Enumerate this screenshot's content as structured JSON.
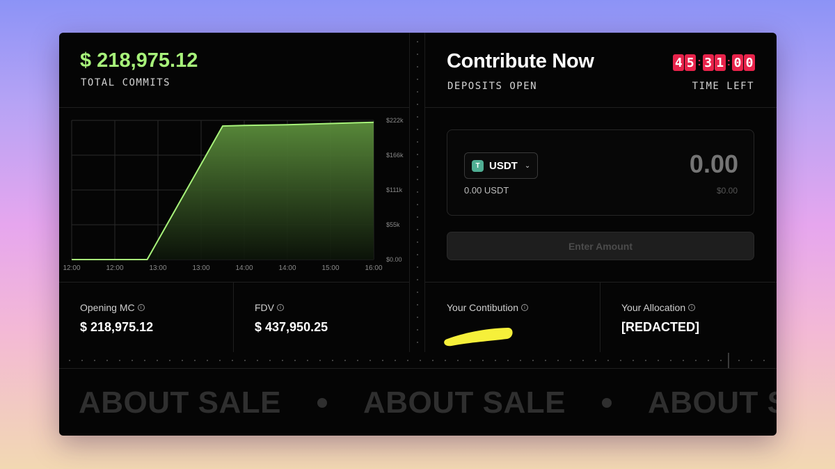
{
  "commits": {
    "value": "$ 218,975.12",
    "label": "TOTAL COMMITS"
  },
  "contribute": {
    "title": "Contribute Now",
    "status": "DEPOSITS OPEN",
    "time_left_label": "TIME LEFT",
    "timer": {
      "d1": "4",
      "d2": "5",
      "d3": "3",
      "d4": "1",
      "d5": "0",
      "d6": "0"
    }
  },
  "deposit": {
    "token": "USDT",
    "token_icon_glyph": "T",
    "balance": "0.00 USDT",
    "amount_placeholder": "0.00",
    "amount_usd": "$0.00",
    "button_label": "Enter Amount"
  },
  "stats": {
    "opening_mc": {
      "label": "Opening MC",
      "value": "$ 218,975.12"
    },
    "fdv": {
      "label": "FDV",
      "value": "$ 437,950.25"
    },
    "your_contribution": {
      "label": "Your Contibution",
      "value": ""
    },
    "your_allocation": {
      "label": "Your Allocation",
      "value": "[REDACTED]"
    }
  },
  "marquee": {
    "text": "ABOUT SALE"
  },
  "colors": {
    "accent_green": "#a7f27a",
    "timer_red": "#e8234b",
    "highlight_yellow": "#f6f03a"
  },
  "chart_data": {
    "type": "area",
    "x": [
      "12:00",
      "12:00",
      "13:00",
      "13:00",
      "14:00",
      "14:00",
      "15:00",
      "16:00"
    ],
    "x_points": [
      {
        "t": "12:00",
        "v": 0
      },
      {
        "t": "13:00",
        "v": 0
      },
      {
        "t": "13:30",
        "v": 213000
      },
      {
        "t": "14:00",
        "v": 214000
      },
      {
        "t": "14:30",
        "v": 215000
      },
      {
        "t": "15:00",
        "v": 217000
      },
      {
        "t": "16:00",
        "v": 218975.12
      }
    ],
    "y_ticks": [
      "$222k",
      "$166k",
      "$111k",
      "$55k",
      "$0.00"
    ],
    "ylim": [
      0,
      222000
    ],
    "grid": true
  }
}
